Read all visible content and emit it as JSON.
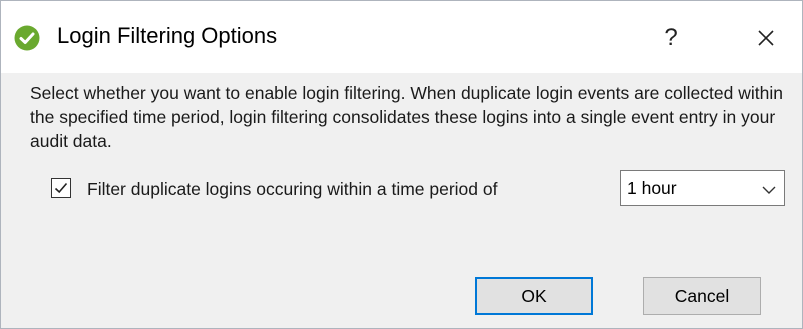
{
  "window": {
    "title": "Login Filtering Options",
    "help_label": "?",
    "close_icon": "close-icon",
    "app_icon": "check-circle-icon",
    "app_icon_color": "#6aa92f"
  },
  "content": {
    "description": "Select whether you want to enable login filtering. When duplicate login events are collected within the specified time period, login filtering consolidates these logins into a single event entry in your audit data.",
    "filter_option": {
      "label": "Filter duplicate logins occuring within a time period of",
      "checked": true
    },
    "time_period": {
      "selected": "1 hour"
    }
  },
  "buttons": {
    "ok_label": "OK",
    "cancel_label": "Cancel",
    "default_border_color": "#0078d7"
  }
}
